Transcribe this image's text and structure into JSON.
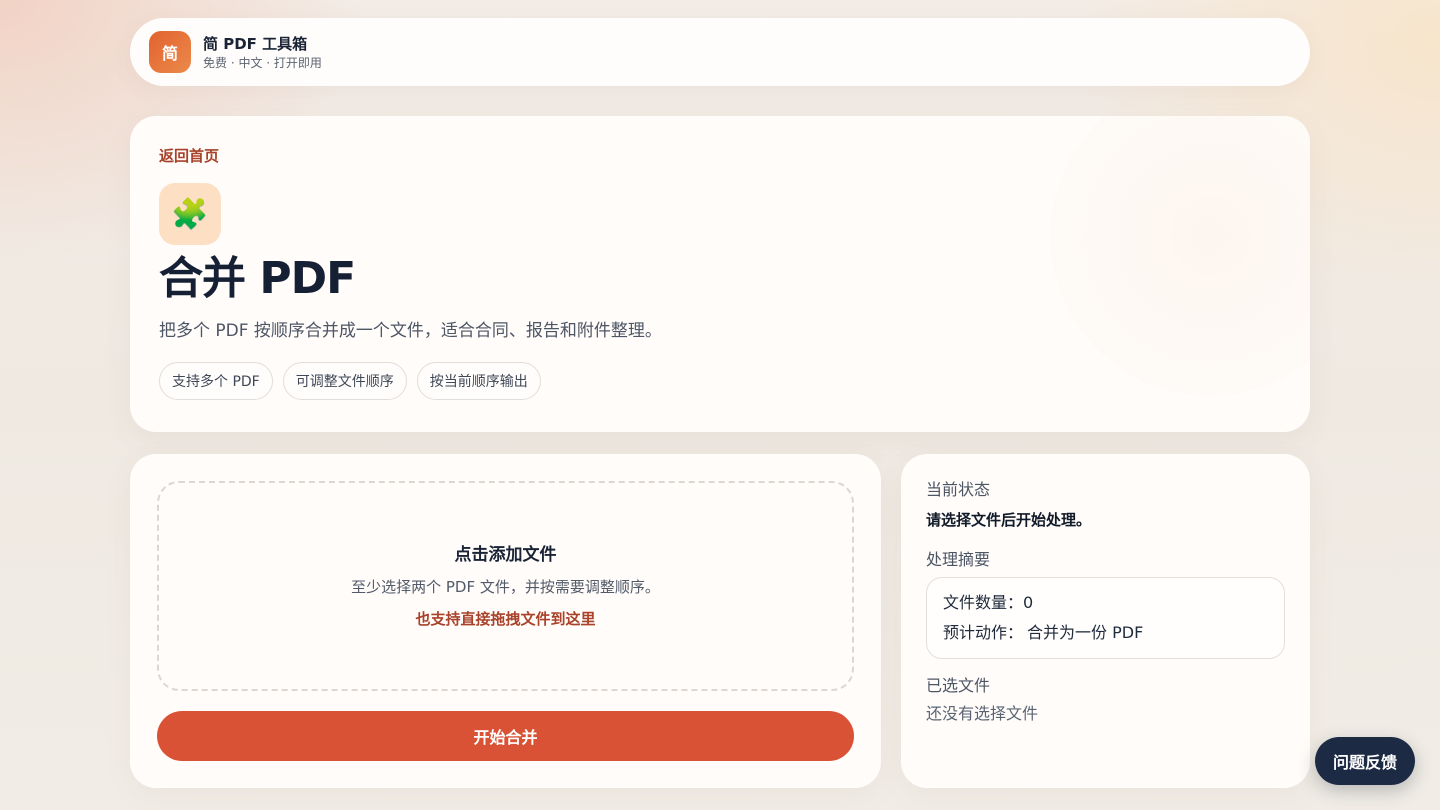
{
  "brand": {
    "logo_text": "简",
    "name": "简 PDF 工具箱",
    "tagline": "免费 · 中文 · 打开即用"
  },
  "hero": {
    "back_link": "返回首页",
    "icon": "puzzle-piece-icon",
    "icon_glyph": "🧩",
    "title": "合并 PDF",
    "description": "把多个 PDF 按顺序合并成一个文件，适合合同、报告和附件整理。",
    "tags": [
      "支持多个 PDF",
      "可调整文件顺序",
      "按当前顺序输出"
    ]
  },
  "upload": {
    "title": "点击添加文件",
    "subtitle": "至少选择两个 PDF 文件，并按需要调整顺序。",
    "drag_hint": "也支持直接拖拽文件到这里",
    "start_button": "开始合并"
  },
  "status": {
    "current_label": "当前状态",
    "current_value": "请选择文件后开始处理。",
    "summary_label": "处理摘要",
    "file_count_label": "文件数量：",
    "file_count_value": "0",
    "action_label": "预计动作：",
    "action_value": "合并为一份 PDF",
    "selected_label": "已选文件",
    "selected_empty": "还没有选择文件"
  },
  "feedback_button": "问题反馈",
  "colors": {
    "accent": "#d95235",
    "link": "#a8422a",
    "dark": "#1c2a44"
  }
}
